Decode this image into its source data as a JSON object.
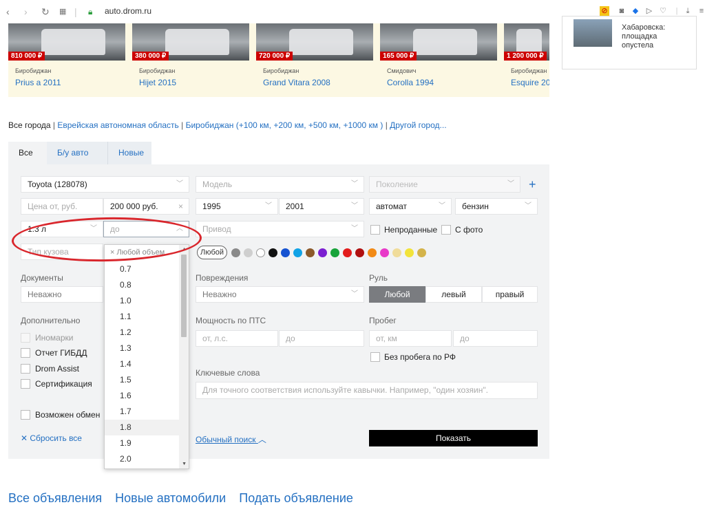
{
  "browser": {
    "url": "auto.drom.ru"
  },
  "cars": [
    {
      "price": "810 000 ₽",
      "city": "Биробиджан",
      "model": "Prius a 2011"
    },
    {
      "price": "380 000 ₽",
      "city": "Биробиджан",
      "model": "Hijet 2015"
    },
    {
      "price": "720 000 ₽",
      "city": "Биробиджан",
      "model": "Grand Vitara 2008"
    },
    {
      "price": "165 000 ₽",
      "city": "Смидович",
      "model": "Corolla 1994"
    },
    {
      "price": "1 200 000 ₽",
      "city": "Биробиджан",
      "model": "Esquire 20"
    }
  ],
  "news": {
    "text": "Хабаровска: площадка опустела"
  },
  "region": {
    "all": "Все города",
    "sep": "|",
    "oblast": "Еврейская автономная область",
    "city": "Биробиджан",
    "open": "(",
    "r100": "+100 км",
    "r200": "+200 км",
    "r500": "+500 км",
    "r1000": "+1000 км",
    "close": ")",
    "other": "Другой город..."
  },
  "tabs": [
    "Все",
    "Б/у авто",
    "Новые"
  ],
  "filters": {
    "make": "Toyota (128078)",
    "model_ph": "Модель",
    "generation_ph": "Поколение",
    "price_from_ph": "Цена от, руб.",
    "price_to": "200 000 руб.",
    "year_from": "1995",
    "year_to": "2001",
    "transmission": "автомат",
    "fuel": "бензин",
    "volume_from": "1.3 л",
    "volume_to_ph": "до",
    "drive_ph": "Привод",
    "unsold": "Непроданные",
    "with_photo": "С фото",
    "body_ph": "Тип кузова",
    "color_any": "Любой",
    "documents_label": "Документы",
    "documents": "Неважно",
    "damage_label": "Повреждения",
    "damage": "Неважно",
    "wheel_label": "Руль",
    "wheel_options": [
      "Любой",
      "левый",
      "правый"
    ],
    "extra_label": "Дополнительно",
    "foreign": "Иномарки",
    "gibdd": "Отчет ГИБДД",
    "drom_assist": "Drom Assist",
    "certification": "Сертификация",
    "exchange": "Возможен обмен",
    "power_label": "Мощность по ПТС",
    "power_from_ph": "от, л.с.",
    "power_to_ph": "до",
    "mileage_label": "Пробег",
    "mileage_from_ph": "от, км",
    "mileage_to_ph": "до",
    "no_mileage_rf": "Без пробега по РФ",
    "keywords_label": "Ключевые слова",
    "keywords_ph": "Для точного соответствия используйте кавычки. Например, \"один хозяин\".",
    "reset": "Сбросить все",
    "simple_search": "Обычный поиск",
    "show": "Показать"
  },
  "colors": [
    "#8a8a8a",
    "#cfcfcf",
    "#ffffff",
    "#111111",
    "#1552d1",
    "#12a3e6",
    "#8c5a2b",
    "#7b1fd1",
    "#18a33a",
    "#e21c1c",
    "#b01010",
    "#f28a16",
    "#e83ac8",
    "#f0dc9a",
    "#f2e33a",
    "#d4b34a"
  ],
  "dropdown": {
    "any": "Любой объем",
    "options": [
      "0.7",
      "0.8",
      "1.0",
      "1.1",
      "1.2",
      "1.3",
      "1.4",
      "1.5",
      "1.6",
      "1.7",
      "1.8",
      "1.9",
      "2.0"
    ],
    "hovered": "1.8"
  },
  "footer": [
    "Все объявления",
    "Новые автомобили",
    "Подать объявление"
  ]
}
